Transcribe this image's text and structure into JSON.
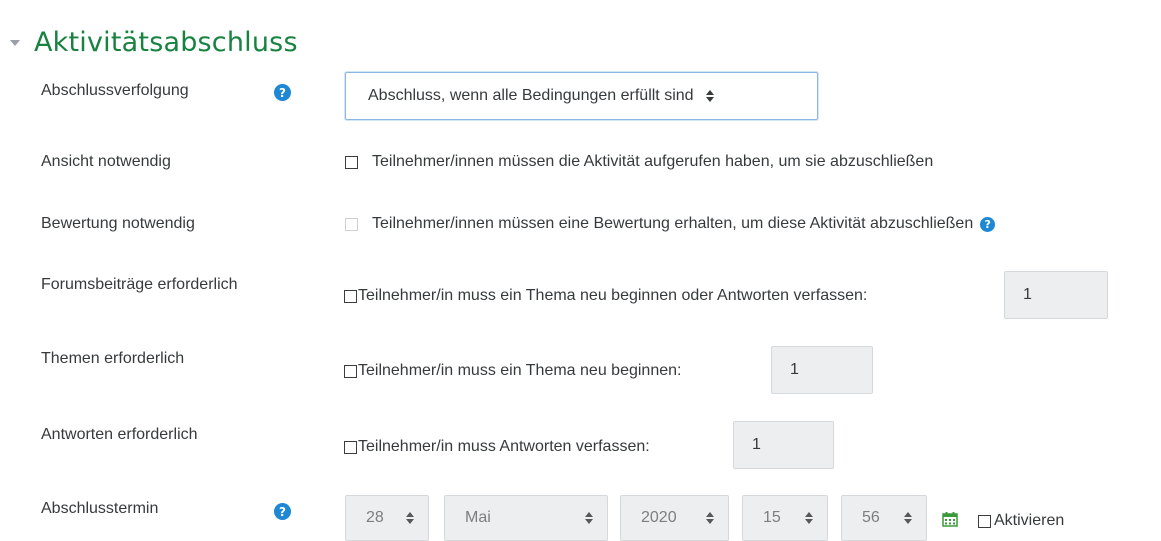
{
  "section": {
    "title": "Aktivitätsabschluss"
  },
  "fields": {
    "tracking": {
      "label": "Abschlussverfolgung",
      "help": "?",
      "select_value": "Abschluss, wenn alle Bedingungen erfüllt sind"
    },
    "view": {
      "label": "Ansicht notwendig",
      "checkbox_text": "Teilnehmer/innen müssen die Aktivität aufgerufen haben, um sie abzuschließen"
    },
    "grade": {
      "label": "Bewertung notwendig",
      "checkbox_text": "Teilnehmer/innen müssen eine Bewertung erhalten, um diese Aktivität abzuschließen",
      "help": "?"
    },
    "posts": {
      "label": "Forumsbeiträge erforderlich",
      "checkbox_text": "Teilnehmer/in muss ein Thema neu beginnen oder Antworten verfassen:",
      "value": "1"
    },
    "discussions": {
      "label": "Themen erforderlich",
      "checkbox_text": "Teilnehmer/in muss ein Thema neu beginnen:",
      "value": "1"
    },
    "replies": {
      "label": "Antworten erforderlich",
      "checkbox_text": "Teilnehmer/in muss Antworten verfassen:",
      "value": "1"
    },
    "expected": {
      "label": "Abschlusstermin",
      "help": "?",
      "day": "28",
      "month": "Mai",
      "year": "2020",
      "hour": "15",
      "minute": "56",
      "enable_text": "Aktivieren"
    }
  },
  "colors": {
    "accent_green": "#188241",
    "help_blue": "#1e88d4",
    "calendar_green": "#3c9a3c"
  }
}
